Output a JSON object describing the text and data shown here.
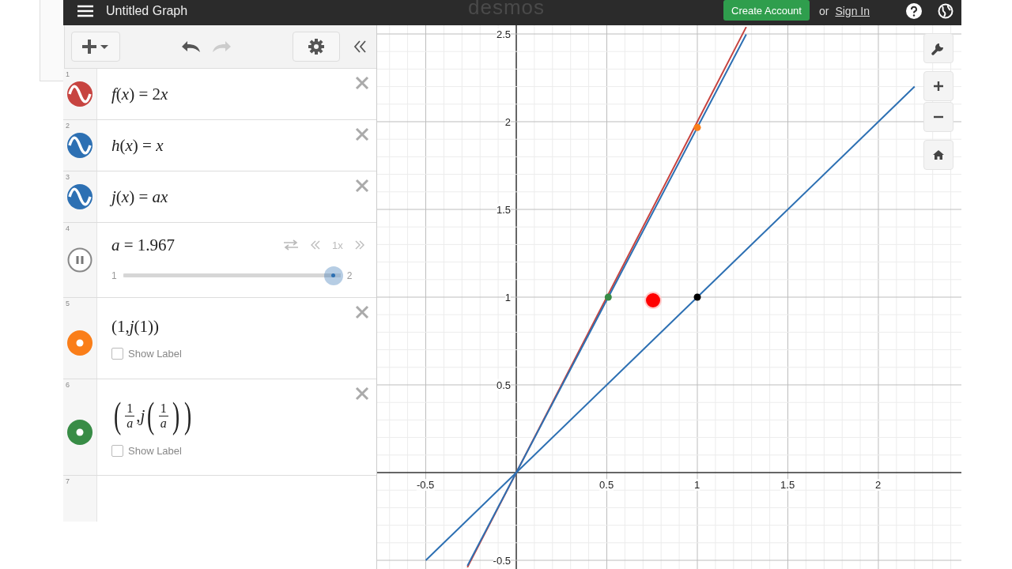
{
  "top_bar": {
    "title": "Untitled Graph",
    "logo": "desmos",
    "create_account": "Create Account",
    "or": "or",
    "sign_in": "Sign In"
  },
  "expressions": [
    {
      "number": "1",
      "kind": "function",
      "color": "#c74440",
      "parts": [
        {
          "kind": "italic",
          "text": "f"
        },
        {
          "kind": "text",
          "text": "("
        },
        {
          "kind": "italic",
          "text": "x"
        },
        {
          "kind": "text",
          "text": ") = 2"
        },
        {
          "kind": "italic",
          "text": "x"
        }
      ]
    },
    {
      "number": "2",
      "kind": "function",
      "color": "#2d70b3",
      "parts": [
        {
          "kind": "italic",
          "text": "h"
        },
        {
          "kind": "text",
          "text": "("
        },
        {
          "kind": "italic",
          "text": "x"
        },
        {
          "kind": "text",
          "text": ") = "
        },
        {
          "kind": "italic",
          "text": "x"
        }
      ]
    },
    {
      "number": "3",
      "kind": "function",
      "color": "#2d70b3",
      "parts": [
        {
          "kind": "italic",
          "text": "j"
        },
        {
          "kind": "text",
          "text": "("
        },
        {
          "kind": "italic",
          "text": "x"
        },
        {
          "kind": "text",
          "text": ") = "
        },
        {
          "kind": "italic",
          "text": "ax"
        }
      ]
    },
    {
      "number": "4",
      "kind": "slider",
      "playing": true,
      "parts": [
        {
          "kind": "italic",
          "text": "a"
        },
        {
          "kind": "text",
          "text": " = 1.967"
        }
      ],
      "min": "1",
      "max": "2",
      "level": 0.967,
      "speed": "1x"
    },
    {
      "number": "5",
      "kind": "point",
      "color": "#fa7e19",
      "parts": [
        {
          "kind": "text",
          "text": "(1,"
        },
        {
          "kind": "italic",
          "text": "j"
        },
        {
          "kind": "text",
          "text": "(1))"
        }
      ],
      "show_label": {
        "label": "Show Label",
        "checked": false
      }
    },
    {
      "number": "6",
      "kind": "point",
      "color": "#388c46",
      "parts": [
        {
          "kind": "paren",
          "text": "("
        },
        {
          "kind": "frac",
          "num": "1",
          "den": "a"
        },
        {
          "kind": "text",
          "text": ","
        },
        {
          "kind": "italic",
          "text": "j"
        },
        {
          "kind": "paren",
          "text": "("
        },
        {
          "kind": "frac",
          "num": "1",
          "den": "a"
        },
        {
          "kind": "paren",
          "text": ")"
        },
        {
          "kind": "paren",
          "text": ")"
        }
      ],
      "show_label": {
        "label": "Show Label",
        "checked": false
      }
    },
    {
      "number": "7",
      "kind": "empty"
    }
  ],
  "graph": {
    "chart_data": {
      "type": "line",
      "grid": true,
      "x": [
        -0.5,
        -0.27,
        0,
        0.5,
        0.508,
        0.75,
        1,
        1.27,
        2,
        2.2
      ],
      "xlim": [
        -0.7686,
        2.4629
      ],
      "ylim": [
        -0.5495,
        2.5495
      ],
      "series": [
        {
          "color": "#c74440",
          "values": [
            null,
            -0.54,
            0,
            1,
            1.016,
            1.5,
            2,
            2.54,
            null,
            null
          ]
        },
        {
          "color": "#2d70b3",
          "values": [
            -0.5,
            -0.27,
            0,
            0.5,
            0.508,
            0.75,
            1,
            1.27,
            2,
            2.2
          ]
        },
        {
          "color": "#2d70b3",
          "values": [
            null,
            -0.531,
            0,
            0.984,
            0.999,
            1.475,
            1.967,
            2.498,
            null,
            null
          ]
        },
        {
          "color": "#fa7e19",
          "marker": true,
          "values": [
            null,
            null,
            null,
            null,
            null,
            null,
            1.967,
            null,
            null,
            null
          ]
        },
        {
          "color": "#388c46",
          "marker": true,
          "values": [
            null,
            null,
            null,
            null,
            1,
            null,
            null,
            null,
            null,
            null
          ]
        },
        {
          "color": "#000000",
          "marker": true,
          "values": [
            null,
            null,
            null,
            null,
            null,
            null,
            1,
            null,
            null,
            null
          ]
        }
      ],
      "xticks": [
        {
          "value": -0.5,
          "label": "-0.5"
        },
        {
          "value": 0.5,
          "label": "0.5"
        },
        {
          "value": 1,
          "label": "1"
        },
        {
          "value": 1.5,
          "label": "1.5"
        },
        {
          "value": 2,
          "label": "2"
        }
      ],
      "yticks": [
        {
          "value": -0.5,
          "label": "-0.5"
        },
        {
          "value": 0.5,
          "label": "0.5"
        },
        {
          "value": 1,
          "label": "1"
        },
        {
          "value": 1.5,
          "label": "1.5"
        },
        {
          "value": 2,
          "label": "2"
        },
        {
          "value": 2.5,
          "label": "2.5"
        }
      ]
    }
  }
}
